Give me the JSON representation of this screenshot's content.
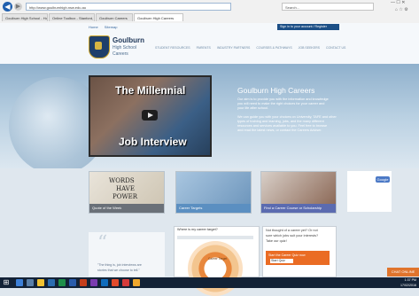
{
  "browser": {
    "address": "http://www.goulburnhigh.nsw.edu.au",
    "search_placeholder": "Search...",
    "tabs": [
      "Goulburn High School - Hom...",
      "Online Toolbox - Stanford, Kirk...",
      "Goulburn Careers",
      "Goulburn High Careers"
    ],
    "window_controls": "—  ☐  ✕",
    "toolbar_icons": "⌂ ☆ ⚙"
  },
  "header": {
    "top_links": [
      "Home",
      "Sitemap"
    ],
    "login_text": "Sign in to your account / Register",
    "logo_name": "Goulburn",
    "logo_sub1": "High School",
    "logo_sub2": "Careers",
    "nav": [
      "STUDENT RESOURCES",
      "PARENTS",
      "INDUSTRY PARTNERS",
      "COURSES & PATHWAYS",
      "JOB SEEKERS",
      "CONTACT US"
    ]
  },
  "hero": {
    "video_title1": "The Millennial",
    "video_title2": "Job Interview",
    "heading": "Goulburn High Careers",
    "text_lines": [
      "Our aim is to provide you with the information and knowledge",
      "you will need to make the right choices for your career and",
      "your life after school.",
      "",
      "We can guide you with your choices on University, TAFE and other",
      "types of training and learning, jobs, and the many different",
      "resources and services available to you. Feel free to browse",
      "and read the latest news, or contact the Careers Adviser."
    ]
  },
  "cards": [
    {
      "label": "Quote of the Week",
      "image": "words-have-power-card"
    },
    {
      "label": "Career Targets",
      "image": "career-targets-card"
    },
    {
      "label": "Find a Career Course or Scholarship",
      "image": "find-career-card"
    },
    {
      "label": "Google",
      "image": "google-card"
    }
  ],
  "quote": {
    "line1": "\"The thing is, job interviews are",
    "line2": "stories that we choose to tell.\""
  },
  "career_target": {
    "title": "Where is my career target?",
    "ring_label": "Career Target"
  },
  "quiz": {
    "lines": [
      "Not thought of a career yet? Or not",
      "sure which jobs suit your interests?",
      "Take our quiz!"
    ],
    "orange_text": "Start the Career Quiz now",
    "button_text": "Start Quiz"
  },
  "chat": {
    "label": "CHAT ONLINE"
  },
  "taskbar": {
    "time": "1:37 PM",
    "date": "17/02/2016"
  },
  "colors": {
    "accent": "#1c4f86",
    "orange": "#ea6c24",
    "taskbar": "#132236"
  }
}
